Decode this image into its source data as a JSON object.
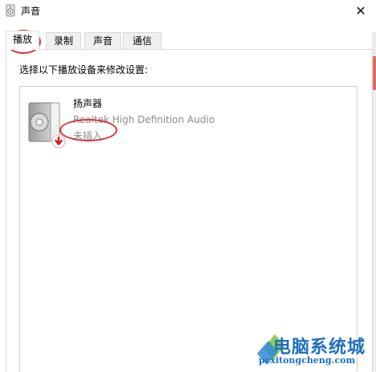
{
  "window": {
    "title": "声音"
  },
  "tabs": [
    {
      "label": "播放",
      "active": true
    },
    {
      "label": "录制",
      "active": false
    },
    {
      "label": "声音",
      "active": false
    },
    {
      "label": "通信",
      "active": false
    }
  ],
  "playback": {
    "instruction": "选择以下播放设备来修改设置:",
    "devices": [
      {
        "name": "扬声器",
        "driver": "Realtek High Definition Audio",
        "status": "未插入",
        "icon": "speaker-icon"
      }
    ]
  },
  "watermark": {
    "text": "电脑系统城",
    "url": "pcxitongcheng.com"
  },
  "colors": {
    "annotation_red": "#d8323a",
    "watermark_blue": "#1d6fc0"
  }
}
